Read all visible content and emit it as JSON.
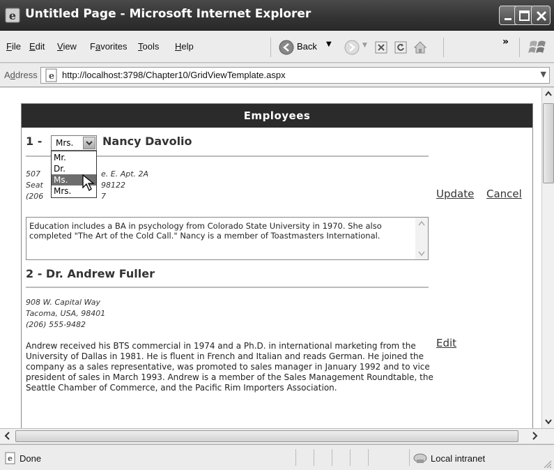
{
  "window": {
    "title": "Untitled Page - Microsoft Internet Explorer"
  },
  "menu": {
    "items": [
      {
        "underline": "F",
        "rest": "ile"
      },
      {
        "underline": "E",
        "rest": "dit"
      },
      {
        "underline": "V",
        "rest": "iew"
      },
      {
        "pre": "F",
        "underline": "a",
        "rest": "vorites"
      },
      {
        "underline": "T",
        "rest": "ools"
      },
      {
        "underline": "H",
        "rest": "elp"
      }
    ],
    "back_label": "Back",
    "overflow": "»"
  },
  "address": {
    "label_pre": "A",
    "label_u": "d",
    "label_post": "dress",
    "url": "http://localhost:3798/Chapter10/GridViewTemplate.aspx"
  },
  "grid": {
    "header": "Employees",
    "employees": [
      {
        "prefix": "1 -",
        "name": "Nancy Davolio",
        "title_selected": "Mrs.",
        "title_options": [
          "Mr.",
          "Dr.",
          "Ms.",
          "Mrs."
        ],
        "title_highlighted": "Ms.",
        "address_lines": [
          "507 ",
          "Seat",
          "(206"
        ],
        "address_right": [
          "e. E. Apt. 2A",
          "98122",
          "7"
        ],
        "bio": "Education includes a BA in psychology from Colorado State University in 1970.  She also completed \"The Art of the Cold Call.\"  Nancy is a member of Toastmasters International.",
        "update_label": "Update",
        "cancel_label": "Cancel"
      },
      {
        "heading": "2 - Dr. Andrew Fuller",
        "address_lines": [
          "908 W. Capital Way",
          "Tacoma, USA, 98401",
          "(206) 555-9482"
        ],
        "bio": "Andrew received his BTS commercial in 1974 and a Ph.D. in international marketing from the University of Dallas in 1981. He is fluent in French and Italian and reads German. He joined the company as a sales representative, was promoted to sales manager in January 1992 and to vice president of sales in March 1993. Andrew is a member of the Sales Management Roundtable, the Seattle Chamber of Commerce, and the Pacific Rim Importers Association.",
        "edit_label": "Edit"
      }
    ]
  },
  "status": {
    "left": "Done",
    "zone": "Local intranet"
  }
}
